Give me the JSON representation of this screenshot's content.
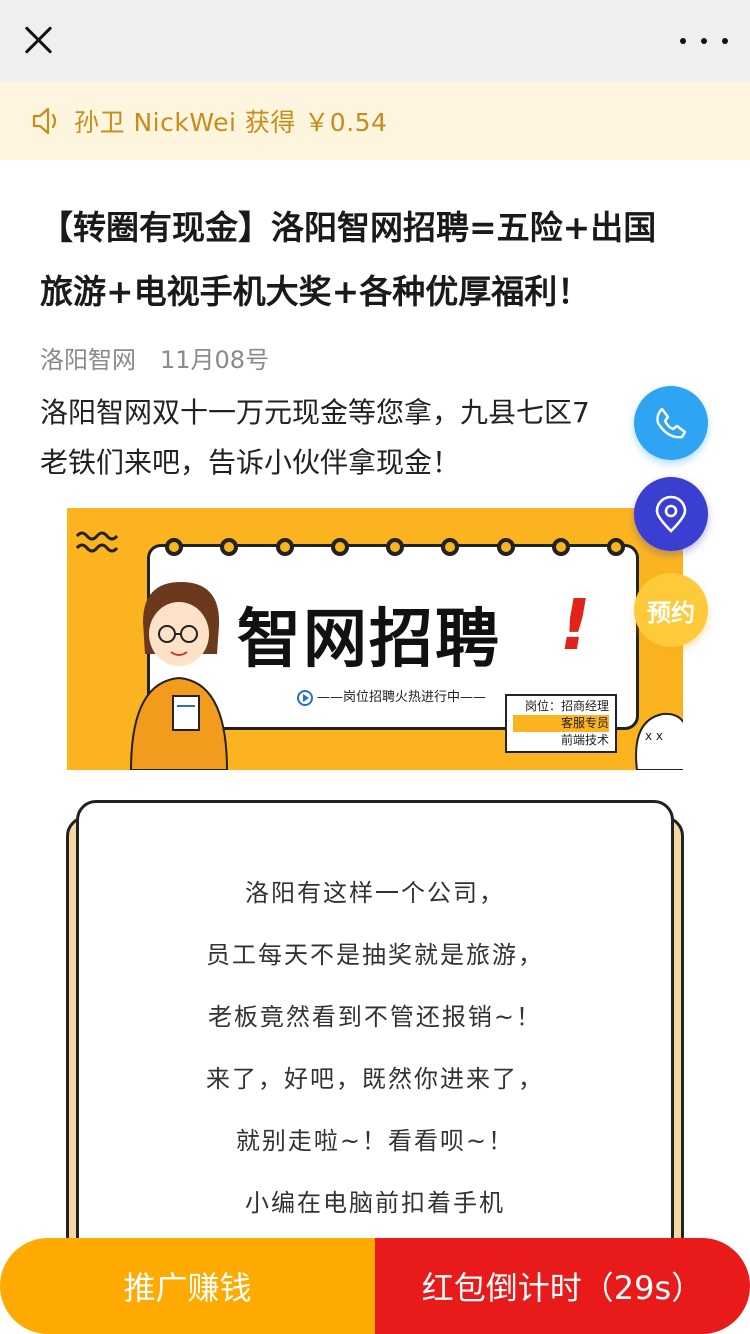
{
  "topbar": {
    "close_icon": "close-icon",
    "more_icon": "more-dots-icon"
  },
  "notice": {
    "icon": "speaker-icon",
    "text": "孙卫 NickWei 获得 ￥0.54",
    "color": "#c88b1c"
  },
  "article": {
    "title_line1": "【转圈有现金】洛阳智网招聘=五险+出国",
    "title_line2": "旅游+电视手机大奖+各种优厚福利！",
    "author": "洛阳智网",
    "date": "11月08号",
    "intro_line1": "洛阳智网双十一万元现金等您拿，九县七区7",
    "intro_line2": "老铁们来吧，告诉小伙伴拿现金！"
  },
  "banner": {
    "headline": "智网招聘",
    "exclaim": "!",
    "subtitle": "——岗位招聘火热进行中——",
    "roles": [
      "岗位：招商经理",
      "客服专员",
      "前端技术"
    ]
  },
  "card": {
    "lines": [
      "洛阳有这样一个公司，",
      "员工每天不是抽奖就是旅游，",
      "老板竟然看到不管还报销~！",
      "来了，好吧，既然你进来了，",
      "就别走啦~！看看呗~！",
      "小编在电脑前扣着手机"
    ]
  },
  "floating": {
    "call_icon": "phone-icon",
    "location_icon": "location-pin-icon",
    "book_label": "预约"
  },
  "bottom": {
    "promo_label": "推广赚钱",
    "packet_label": "红包倒计时（29s）",
    "promo_color": "#ffaa00",
    "packet_color": "#e81a1a"
  }
}
